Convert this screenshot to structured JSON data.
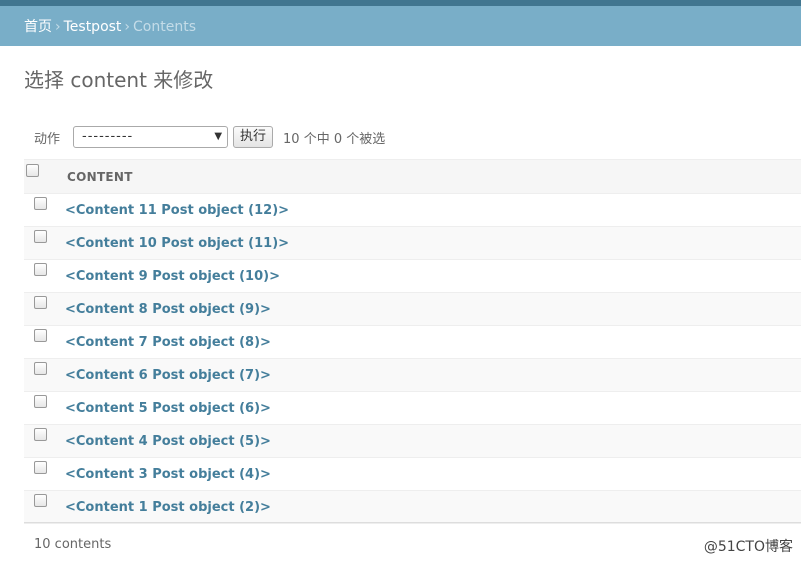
{
  "breadcrumbs": {
    "home": "首页",
    "app": "Testpost",
    "current": "Contents",
    "separator": "›"
  },
  "page_title": "选择 content 来修改",
  "actions": {
    "label": "动作",
    "selected_option": "---------",
    "run_label": "执行",
    "counter": "10 个中 0 个被选"
  },
  "table": {
    "column_header": "CONTENT",
    "rows": [
      "<Content 11 Post object (12)>",
      "<Content 10 Post object (11)>",
      "<Content 9 Post object (10)>",
      "<Content 8 Post object (9)>",
      "<Content 7 Post object (8)>",
      "<Content 6 Post object (7)>",
      "<Content 5 Post object (6)>",
      "<Content 4 Post object (5)>",
      "<Content 3 Post object (4)>",
      "<Content 1 Post object (2)>"
    ]
  },
  "paginator": "10 contents",
  "watermark": "@51CTO博客",
  "colors": {
    "header_strip": "#417690",
    "breadcrumb_bar": "#79aec8",
    "link": "#447e9b"
  }
}
